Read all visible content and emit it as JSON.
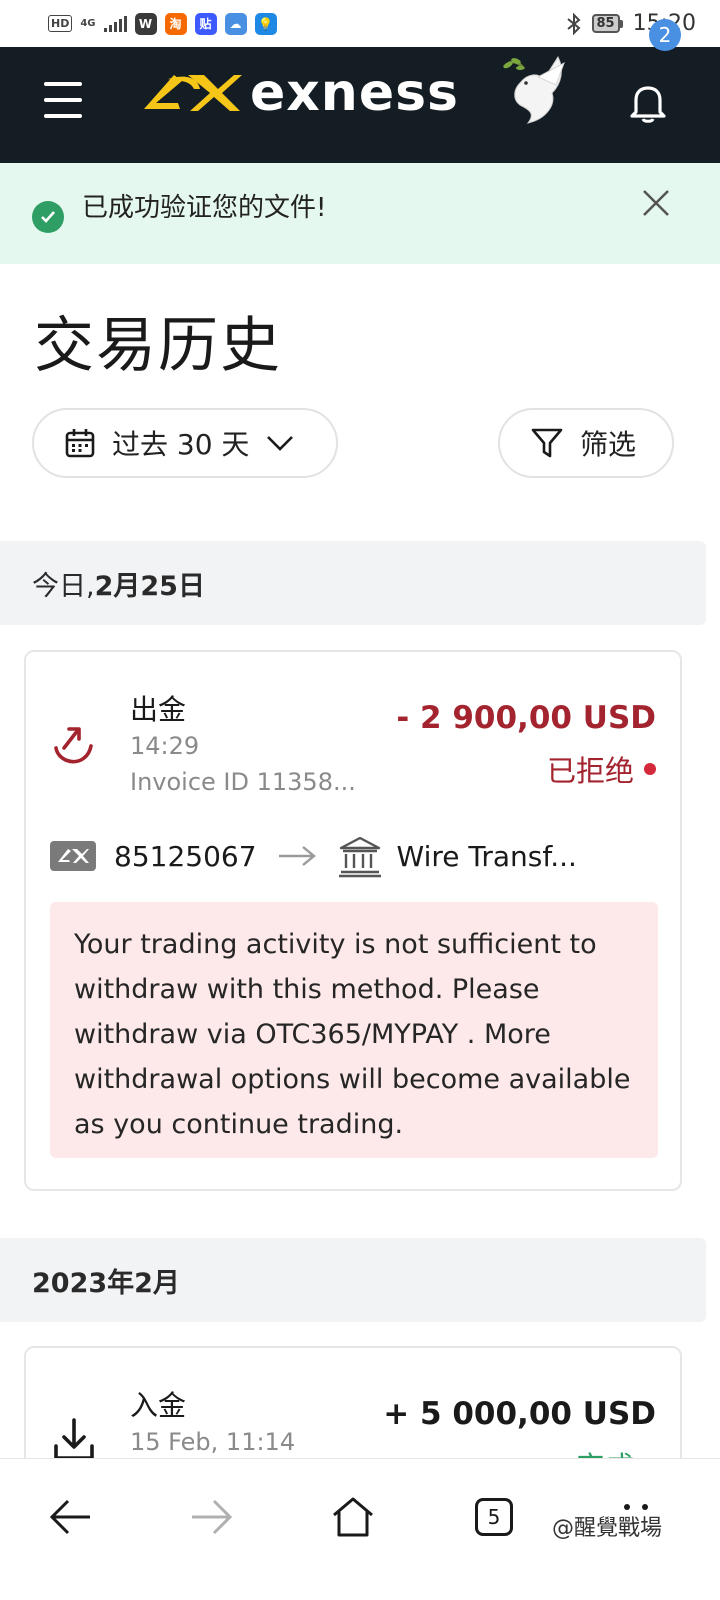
{
  "status_bar": {
    "hd_badge": "HD",
    "network": "4G",
    "time": "15:20",
    "battery": "85",
    "app_icons": [
      {
        "name": "w-app-icon",
        "glyph": "W",
        "color": "#3a3a3a"
      },
      {
        "name": "taobao-app-icon",
        "glyph": "淘",
        "color": "#f56a00"
      },
      {
        "name": "tieba-app-icon",
        "glyph": "贴",
        "color": "#3d5afe"
      },
      {
        "name": "weather-app-icon",
        "glyph": "☁",
        "color": "#4a90e2"
      },
      {
        "name": "bulb-app-icon",
        "glyph": "💡",
        "color": "#1e88e5"
      }
    ]
  },
  "header": {
    "brand": "exness",
    "notification_count": "2"
  },
  "banner": {
    "message": "已成功验证您的文件!"
  },
  "page": {
    "title": "交易历史"
  },
  "filters": {
    "date_range": "过去 30 天",
    "filter_label": "筛选"
  },
  "groups": [
    {
      "header_prefix": "今日, ",
      "header_date": "2月25日",
      "transaction": {
        "type": "出金",
        "time": "14:29",
        "invoice": "Invoice ID 11358...",
        "amount": "- 2 900,00 USD",
        "status": "已拒绝",
        "account": "85125067",
        "method": "Wire Transf...",
        "message": "Your trading activity is not sufficient to withdraw with this method. Please withdraw via OTC365/MYPAY . More withdrawal options will become available as you continue trading."
      }
    },
    {
      "header": "2023年2月",
      "transaction": {
        "type": "入金",
        "time": "15 Feb, 11:14",
        "amount": "+ 5 000,00 USD",
        "status": "完成"
      }
    }
  ],
  "bottom_nav": {
    "tabs_count": "5"
  },
  "watermark": "@醒覺戰場",
  "colors": {
    "header_bg": "#141d23",
    "brand_yellow": "#f5c518",
    "success_green": "#2f9e64",
    "banner_bg": "#e5f8ef",
    "rejected_red": "#a3232e",
    "alert_bg": "#fde9ea",
    "complete_green": "#2f9e64"
  }
}
